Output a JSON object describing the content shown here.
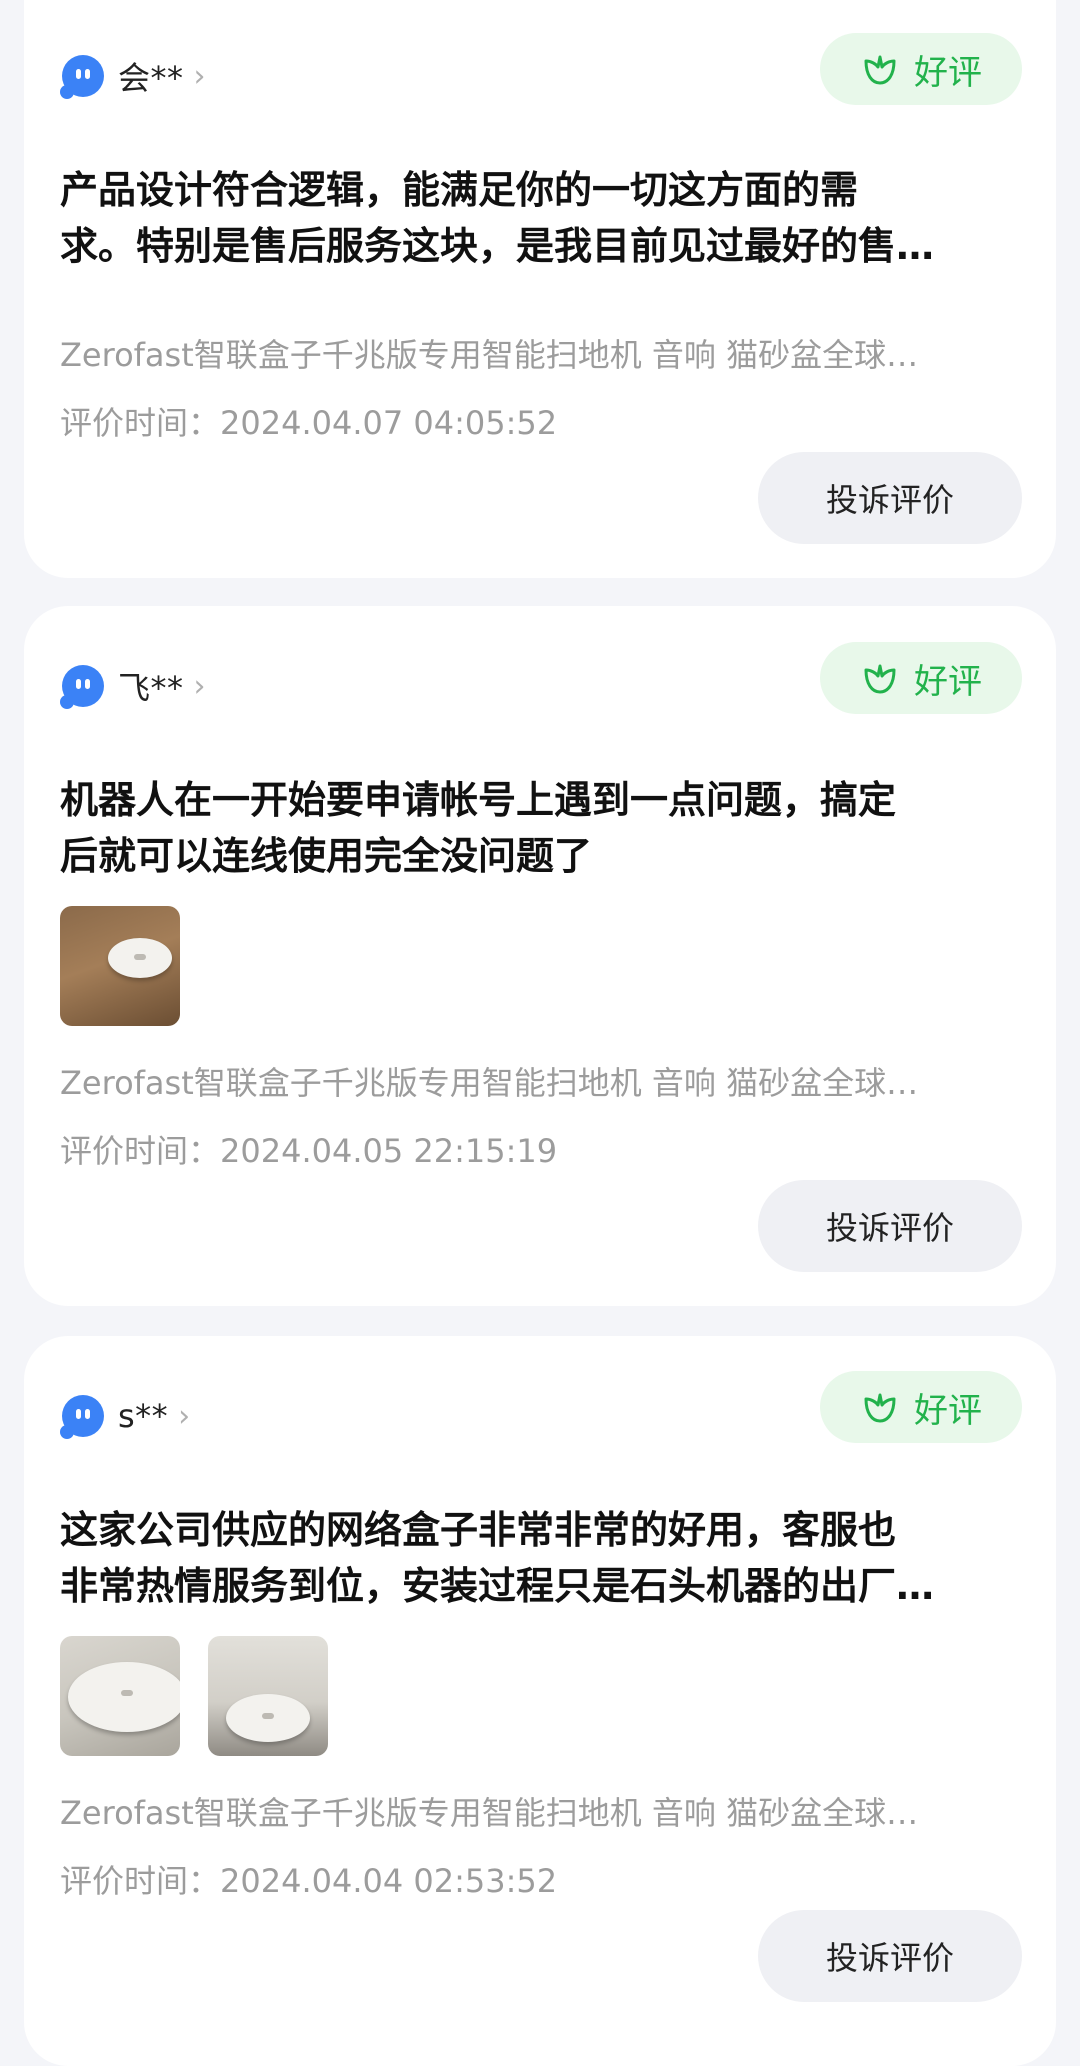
{
  "reviews": [
    {
      "user": "会**",
      "badge": "好评",
      "content_lines": [
        "产品设计符合逻辑，能满足你的一切这方面的需",
        "求。特别是售后服务这块，是我目前见过最好的售…"
      ],
      "product": "Zerofast智联盒子千兆版专用智能扫地机 音响 猫砂盆全球…",
      "time": "评价时间：2024.04.07 04:05:52",
      "complain": "投诉评价",
      "photos": []
    },
    {
      "user": "飞**",
      "badge": "好评",
      "content_lines": [
        "机器人在一开始要申请帐号上遇到一点问题，搞定",
        "后就可以连线使用完全没问题了"
      ],
      "product": "Zerofast智联盒子千兆版专用智能扫地机 音响 猫砂盆全球…",
      "time": "评价时间：2024.04.05 22:15:19",
      "complain": "投诉评价",
      "photos": [
        "robot-vacuum-on-wood-floor"
      ]
    },
    {
      "user": "s**",
      "badge": "好评",
      "content_lines": [
        "这家公司供应的网络盒子非常非常的好用，客服也",
        "非常热情服务到位，安装过程只是石头机器的出厂…"
      ],
      "product": "Zerofast智联盒子千兆版专用智能扫地机 音响 猫砂盆全球…",
      "time": "评价时间：2024.04.04 02:53:52",
      "complain": "投诉评价",
      "photos": [
        "robot-vacuum-closeup",
        "robot-vacuum-docking-station"
      ]
    }
  ],
  "icons": {
    "avatar": "user-avatar-icon",
    "chevron": "chevron-right-icon",
    "badge": "flower-icon"
  },
  "colors": {
    "avatar": "#3b82f6",
    "badge_bg": "#e8f8ea",
    "badge_text": "#22b24c",
    "secondary_text": "#9c9c9c",
    "button_bg": "#eff0f4"
  }
}
